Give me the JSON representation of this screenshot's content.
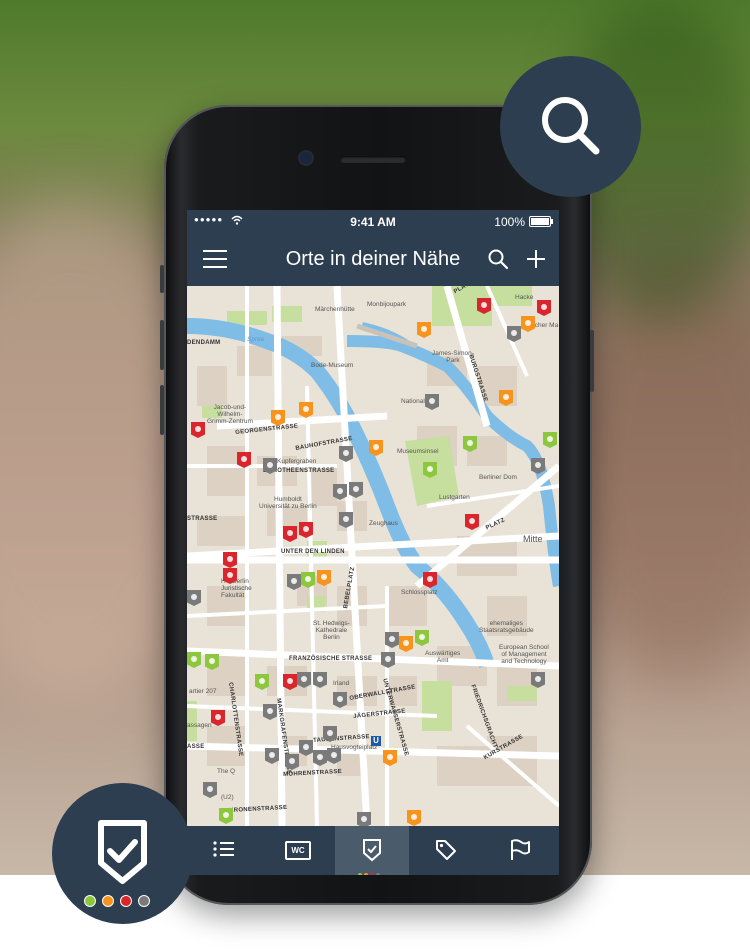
{
  "status_bar": {
    "signal": "●●●●●",
    "time": "9:41 AM",
    "battery": "100%"
  },
  "nav": {
    "title": "Orte in deiner Nähe",
    "menu_icon": "hamburger-menu-icon",
    "search_icon": "search-icon",
    "add_icon": "plus-icon"
  },
  "map": {
    "labels": {
      "maerchenhuette": "Märchenhütte",
      "monbijoupark": "Monbijoupark",
      "spree": "Spree",
      "bode_museum": "Bode-Museum",
      "james_simon": "James-Simon-\nPark",
      "burgstrasse": "BURGSTRASSE",
      "dendamm": "DENDAMM",
      "national": "National",
      "jacob_wilhelm": "Jacob-und-\nWilhelm-\nGrimm-Zentrum",
      "georgenstrasse": "GEORGENSTRASSE",
      "bauhofstrasse": "BAUHOFSTRASSE",
      "museumsinsel": "Museumsinsel",
      "kupfergraben": "Kupfergraben",
      "berliner_dom": "Berliner Dom",
      "dorotheenstrasse": "DOROTHEENSTRASSE",
      "humboldt": "Humboldt\nUniversität zu Berlin",
      "lustgarten": "Lustgarten",
      "zeughaus": "Zeughaus",
      "strasse": "STRASSE",
      "unter_den_linden": "UNTER DEN LINDEN",
      "mitte": "Mitte",
      "hackescher": "Hacke",
      "hackescher_markt": "keescher Ma",
      "platz": "PLATZ",
      "hu_berlin": "HU Berlin\nJuristische\nFakultät",
      "bebelplatz": "BEBELPLATZ",
      "schlossplatz": "Schlossplatz",
      "hedwigs": "St. Hedwigs-\nKathedrale\nBerlin",
      "staatsrat": "ehemaliges\nStaatsratsgebäude",
      "esmt": "European School\nof Management\nand Technology",
      "franzoesische": "FRANZÖSISCHE STRASSE",
      "auswaertiges": "Auswärtiges\nAmt",
      "charlotten": "CHARLOTTENSTRASSE",
      "quartier": "artier 207",
      "irland": "Irland",
      "oberwall": "OBERWALLSTRASSE",
      "unterwasser": "UNTERWASSERSTRASSE",
      "kurstrasse": "KURSTRASSE",
      "friedrichs": "FRIEDRICHSGRACHT",
      "jaegerstrasse": "JÄGERSTRASSE",
      "markgrafen": "MARKGRAFENSTRASSE",
      "taubenstrasse": "TAUBENSTRASSE",
      "hausvogteiplatz": "Hausvogteiplatz",
      "mohrenstrasse": "MOHRENSTRASSE",
      "kronenstrasse": "KRONENSTRASSE",
      "the_q": "The Q",
      "u2": "(U2)",
      "u_sign": "U",
      "strasse2": "STRASSE",
      "ssen": "assagen",
      "ssen2": "ASSE"
    }
  },
  "filter_popup": {
    "green_label": "✓",
    "orange_label": "—",
    "red_label": "✕",
    "gray_label": "○"
  },
  "tabs": [
    {
      "icon": "list-icon"
    },
    {
      "icon": "wc-icon",
      "label": "WC"
    },
    {
      "icon": "shield-check-icon"
    },
    {
      "icon": "tag-icon"
    },
    {
      "icon": "flag-icon"
    }
  ],
  "colors": {
    "primary": "#2c3e50",
    "green": "#8dc63f",
    "orange": "#f7941d",
    "red": "#d9262c",
    "gray": "#7a7a7a"
  }
}
